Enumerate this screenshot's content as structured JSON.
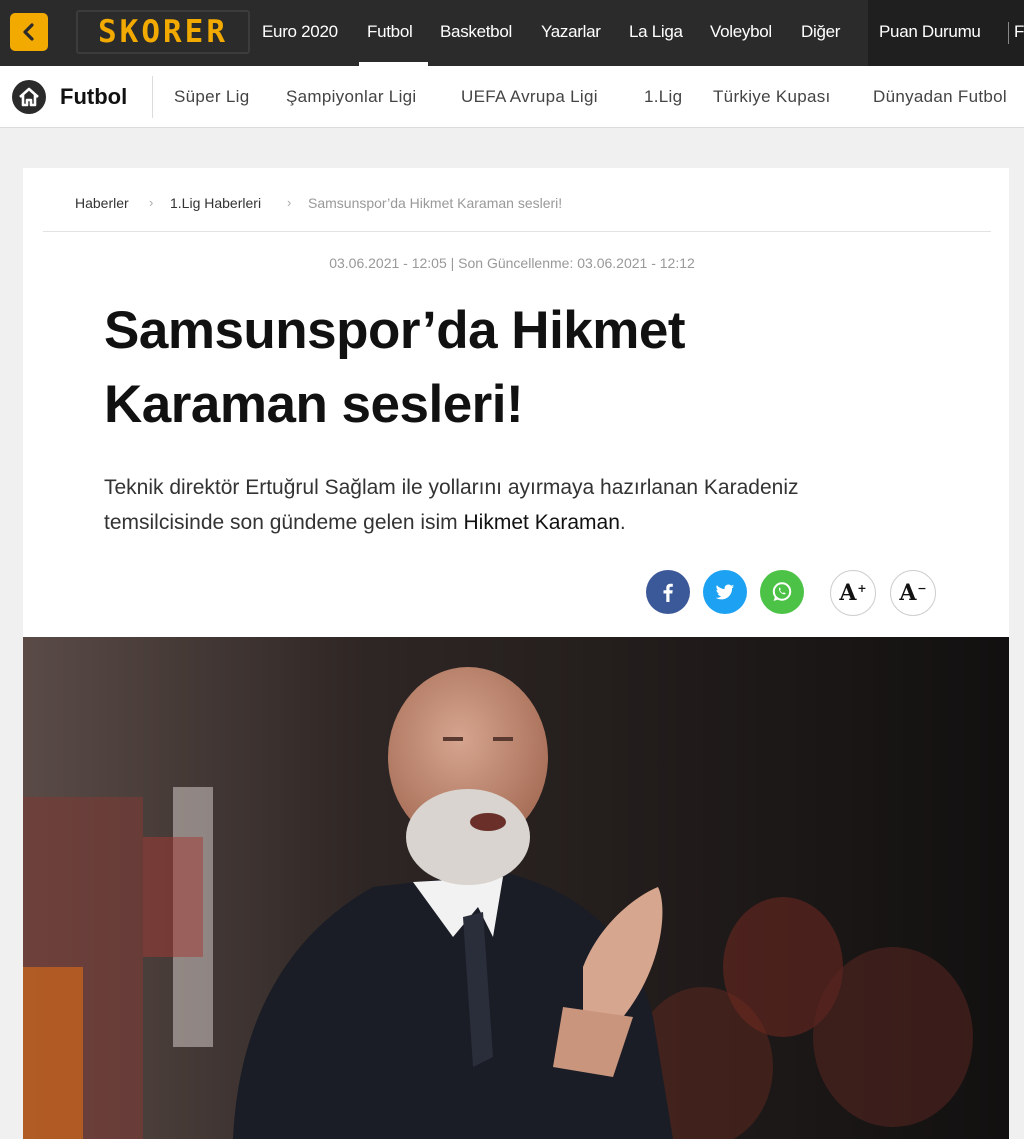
{
  "topbar": {
    "logo_text": "SKORER",
    "nav": [
      "Euro 2020",
      "Futbol",
      "Basketbol",
      "Yazarlar",
      "La Liga",
      "Voleybol",
      "Diğer"
    ],
    "active": "Futbol",
    "right_item": "Puan Durumu",
    "right_item_cut": "F",
    "accent": "#f2a900",
    "icons": {
      "back": "chevron-left-icon"
    }
  },
  "subnav": {
    "title": "Futbol",
    "items": [
      "Süper Lig",
      "Şampiyonlar Ligi",
      "UEFA Avrupa Ligi",
      "1.Lig",
      "Türkiye Kupası",
      "Dünyadan Futbol"
    ],
    "icons": {
      "home": "home-icon"
    }
  },
  "breadcrumb": [
    "Haberler",
    "1.Lig Haberleri",
    "Samsunspor’da Hikmet Karaman sesleri!"
  ],
  "article": {
    "date": "03.06.2021 - 12:05 | Son Güncellenme: 03.06.2021 - 12:12",
    "title": "Samsunspor’da Hikmet Karaman sesleri!",
    "lead_prefix": "Teknik direktör Ertuğrul Sağlam ile yollarını ayırmaya hazırlanan Karadeniz temsilcisinde son gündeme gelen isim ",
    "lead_link": "Hikmet Karaman",
    "lead_suffix": "."
  },
  "actions": {
    "share": [
      {
        "name": "facebook-icon",
        "color": "#3b5998"
      },
      {
        "name": "twitter-icon",
        "color": "#1da1f2"
      },
      {
        "name": "whatsapp-icon",
        "color": "#4cc247"
      }
    ],
    "font_increase": "A",
    "font_increase_sup": "+",
    "font_decrease": "A",
    "font_decrease_sup": "−"
  },
  "image": {
    "subject": "coach-photo"
  }
}
